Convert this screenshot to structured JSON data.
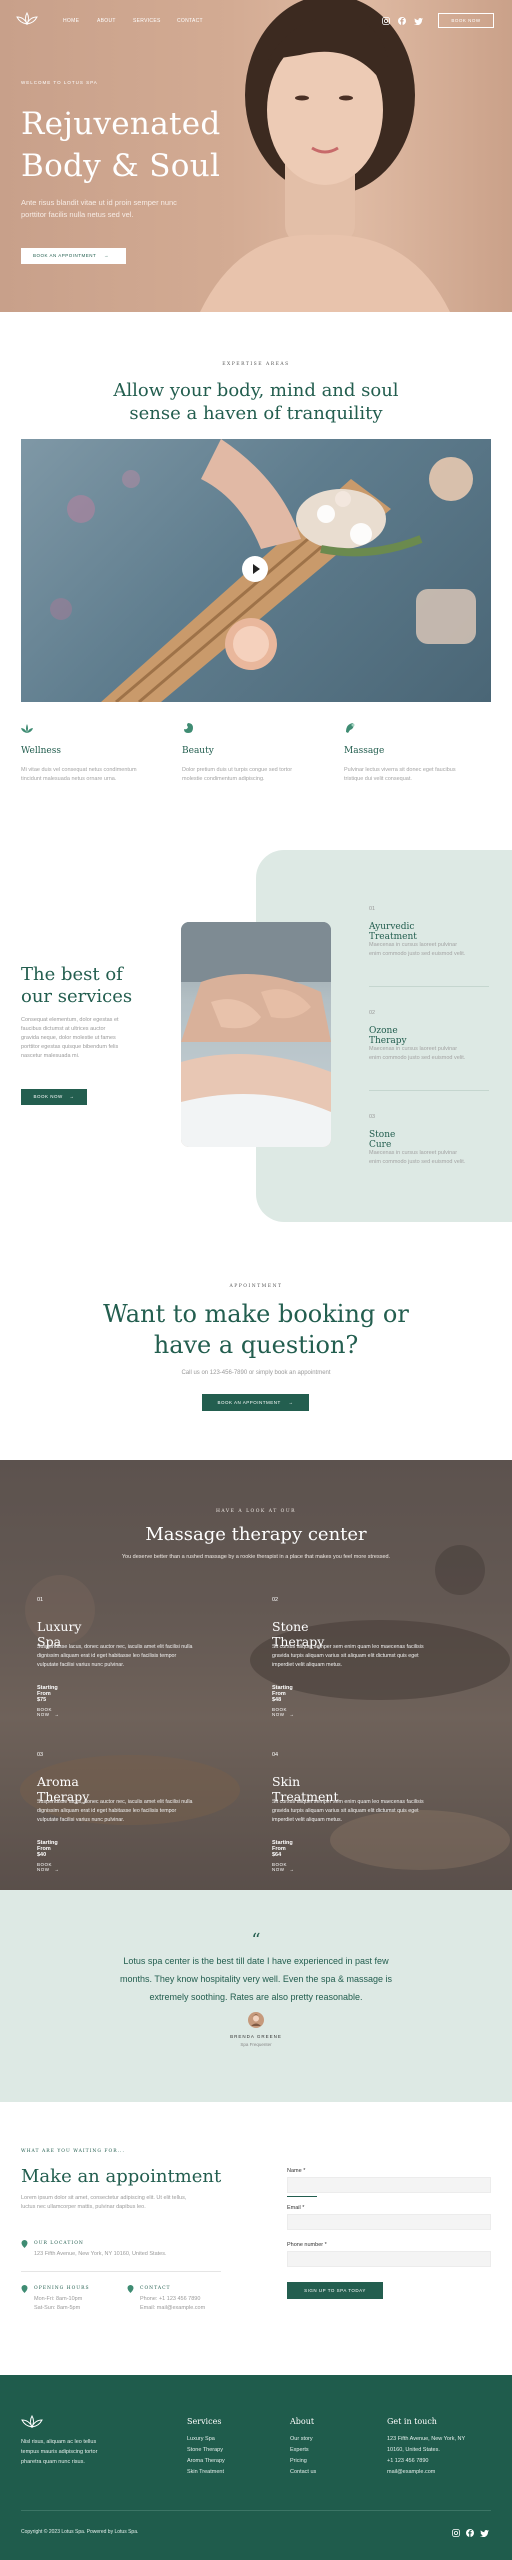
{
  "brand": {
    "name": "Lotus Spa"
  },
  "nav": {
    "items": [
      "HOME",
      "ABOUT",
      "SERVICES",
      "CONTACT"
    ],
    "book_now": "BOOK NOW"
  },
  "hero": {
    "eyebrow": "WELCOME TO LOTUS SPA",
    "title_line1": "Rejuvenated",
    "title_line2": "Body & Soul",
    "text_line1": "Ante risus blandit vitae ut id proin semper nunc",
    "text_line2": "porttitor facilis nulla netus sed vel.",
    "cta": "BOOK AN APPOINTMENT"
  },
  "expertise": {
    "eyebrow": "EXPERTISE AREAS",
    "title_line1": "Allow your body, mind and soul",
    "title_line2": "sense a haven of tranquility",
    "features": [
      {
        "title": "Wellness",
        "line1": "Mi vitae duis vel consequat netus condimentum",
        "line2": "tincidunt malesuada netus ornare urna."
      },
      {
        "title": "Beauty",
        "line1": "Dolor pretium duis ut turpis congue sed tortor",
        "line2": "molestie condimentum adipiscing."
      },
      {
        "title": "Massage",
        "line1": "Pulvinar lectus viverra sit donec eget faucibus",
        "line2": "tristique dui velit consequat."
      }
    ]
  },
  "services": {
    "title_line1": "The best of",
    "title_line2": "our services",
    "text_lines": [
      "Consequat elementum, dolor egestas et",
      "faucibus dictumst at ultrices auctor",
      "gravida neque, dolor molestie ut fames",
      "porttitor egestas quisque bibendum felis",
      "nascetur malesuada mi."
    ],
    "cta": "BOOK NOW",
    "items": [
      {
        "num": "01",
        "title": "Ayurvedic Treatment",
        "line1": "Maecenas in cursus laoreet pulvinar",
        "line2": "enim commodo justo sed euismod velit."
      },
      {
        "num": "02",
        "title": "Ozone Therapy",
        "line1": "Maecenas in cursus laoreet pulvinar",
        "line2": "enim commodo justo sed euismod velit."
      },
      {
        "num": "03",
        "title": "Stone Cure",
        "line1": "Maecenas in cursus laoreet pulvinar",
        "line2": "enim commodo justo sed euismod velit."
      }
    ]
  },
  "booking": {
    "eyebrow": "APPOINTMENT",
    "title_line1": "Want to make booking or",
    "title_line2": "have a question?",
    "subtitle": "Call us on 123-456-7890 or simply book an appointment",
    "cta": "BOOK AN APPOINTMENT"
  },
  "center": {
    "eyebrow": "HAVE A LOOK AT OUR",
    "title": "Massage therapy center",
    "subtitle": "You deserve better than a rushed massage by a rookie therapist in a place that makes you feel more stressed.",
    "cards": [
      {
        "num": "01",
        "title": "Luxury Spa",
        "line1": "Suspendisse lacus, donec auctor nec, iaculis amet elit facilisi nulla",
        "line2": "dignissim aliquam erat id eget habitasse leo facilisis tempor",
        "line3": "vulputate facilisi varius nunc pulvinar.",
        "price": "Starting From $75",
        "book": "BOOK NOW"
      },
      {
        "num": "02",
        "title": "Stone Therapy",
        "line1": "Sit cursus aliquet semper sem enim quam leo maecenas facilisis",
        "line2": "gravida turpis aliquam varius sit aliquam elit dictumst quis eget",
        "line3": "imperdiet velit aliquam metus.",
        "price": "Starting From $48",
        "book": "BOOK NOW"
      },
      {
        "num": "03",
        "title": "Aroma Therapy",
        "line1": "Suspendisse lacus, donec auctor nec, iaculis amet elit facilisi nulla",
        "line2": "dignissim aliquam erat id eget habitasse leo facilisis tempor",
        "line3": "vulputate facilisi varius nunc pulvinar.",
        "price": "Starting From $40",
        "book": "BOOK NOW"
      },
      {
        "num": "04",
        "title": "Skin Treatment",
        "line1": "Sit cursus aliquet semper sem enim quam leo maecenas facilisis",
        "line2": "gravida turpis aliquam varius sit aliquam elit dictumst quis eget",
        "line3": "imperdiet velit aliquam metus.",
        "price": "Starting From $64",
        "book": "BOOK NOW"
      }
    ]
  },
  "testimonial": {
    "quote_line1": "Lotus spa center is the best till date I have experienced in past few",
    "quote_line2": "months. They know hospitality very well. Even the spa & massage is",
    "quote_line3": "extremely soothing. Rates are also pretty reasonable.",
    "author": "BRENDA GREENE",
    "role": "Spa Frequenter"
  },
  "appointment": {
    "eyebrow": "WHAT ARE YOU WAITING FOR...",
    "title": "Make an appointment",
    "text_line1": "Lorem ipsum dolor sit amet, consectetur adipiscing elit. Ut elit tellus,",
    "text_line2": "luctus nec ullamcorper mattis, pulvinar dapibus leo.",
    "location_label": "OUR LOCATION",
    "location": "123 Fifth Avenue, New York, NY 10160, United States.",
    "hours_label": "OPENING HOURS",
    "hours_line1": "Mon-Fri: 8am-10pm",
    "hours_line2": "Sat-Sun: 8am-5pm",
    "contact_label": "CONTACT",
    "phone": "Phone: +1 123 456 7890",
    "email": "Email: mail@example.com",
    "form": {
      "name_label": "Name *",
      "email_label": "Email *",
      "phone_label": "Phone number *",
      "submit": "SIGN UP TO SPA TODAY"
    }
  },
  "footer": {
    "about_line1": "Nisl risus, aliquam ac leo tellus",
    "about_line2": "tempus mauris adipiscing tortor",
    "about_line3": "pharetra quam nunc risus.",
    "services_heading": "Services",
    "services": [
      "Luxury Spa",
      "Stone Therapy",
      "Aroma Therapy",
      "Skin Treatment"
    ],
    "about_heading": "About",
    "about_links": [
      "Our story",
      "Experts",
      "Pricing",
      "Contact us"
    ],
    "contact_heading": "Get in touch",
    "contact": [
      "123 Fifth Avenue, New York, NY",
      "10160, United States.",
      "+1 123 456 7890",
      "mail@example.com"
    ],
    "copyright": "Copyright © 2023 Lotus Spa. Powered by Lotus Spa."
  },
  "colors": {
    "accent": "#235e4f",
    "mint": "#dde9e4",
    "skin": "#d3ab93"
  },
  "icons": [
    "lotus-logo-icon",
    "instagram-icon",
    "facebook-icon",
    "twitter-icon",
    "play-icon",
    "arrow-right-icon",
    "quote-icon",
    "map-pin-icon"
  ]
}
